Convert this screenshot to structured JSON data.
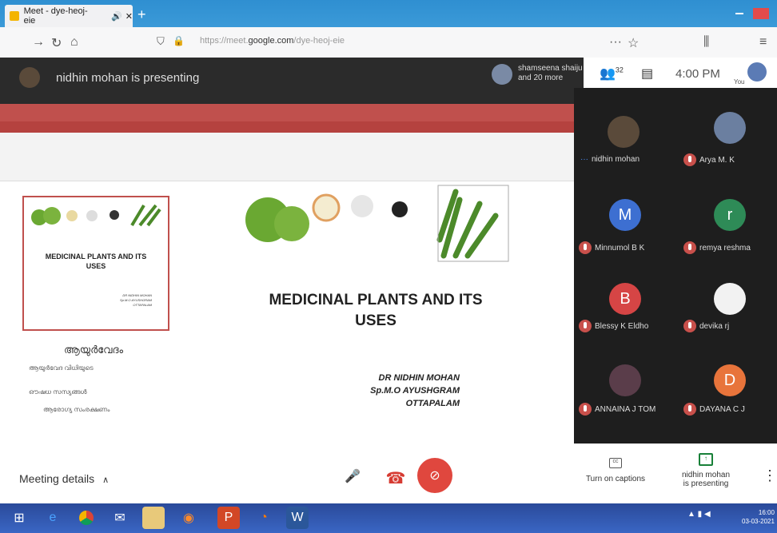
{
  "browser": {
    "tab_title": "Meet - dye-heoj-eie",
    "url_prefix": "https://meet.",
    "url_domain": "google.com",
    "url_path": "/dye-heoj-eie"
  },
  "meet": {
    "presenting_banner": "nidhin mohan is presenting",
    "others_line1": "shamseena shaiju",
    "others_line2": "and 20 more",
    "participant_count": "32",
    "time": "4:00 PM",
    "you_label": "You",
    "meeting_details": "Meeting details",
    "captions_label": "Turn on captions",
    "presenting_label_1": "nidhin mohan",
    "presenting_label_2": "is presenting"
  },
  "slide": {
    "title_line1": "MEDICINAL PLANTS AND ITS",
    "title_line2": "USES",
    "author1": "DR NIDHIN MOHAN",
    "author2": "Sp.M.O AYUSHGRAM",
    "author3": "OTTAPALAM"
  },
  "thumbnail": {
    "title_line1": "MEDICINAL PLANTS AND ITS",
    "title_line2": "USES",
    "author1": "DR NIDHIN MOHAN",
    "author2": "Sp.M.O AYUSHGRAM",
    "author3": "OTTAPALAM"
  },
  "notes": {
    "heading": "ആയുർവേദം",
    "items": [
      "ആയുർവേദ വിധിയുടെ",
      "ഔഷധ സസ്യങ്ങൾ",
      "ആരോഗ്യ സംരക്ഷണം"
    ]
  },
  "participants": [
    {
      "name": "nidhin mohan",
      "initial": "",
      "color": "#5a4a3a"
    },
    {
      "name": "Arya M. K",
      "initial": "",
      "color": "#6b7fa0"
    },
    {
      "name": "Minnumol B K",
      "initial": "M",
      "color": "#3d6fd1"
    },
    {
      "name": "remya reshma",
      "initial": "r",
      "color": "#2e8b57"
    },
    {
      "name": "Blessy K Eldho",
      "initial": "B",
      "color": "#d64545"
    },
    {
      "name": "devika rj",
      "initial": "",
      "color": "#f2f2f2"
    },
    {
      "name": "ANNAINA J TOM",
      "initial": "",
      "color": "#5a3d4a"
    },
    {
      "name": "DAYANA C J",
      "initial": "D",
      "color": "#e8743b"
    }
  ],
  "taskbar": {
    "time": "16:00",
    "date": "03-03-2021"
  }
}
